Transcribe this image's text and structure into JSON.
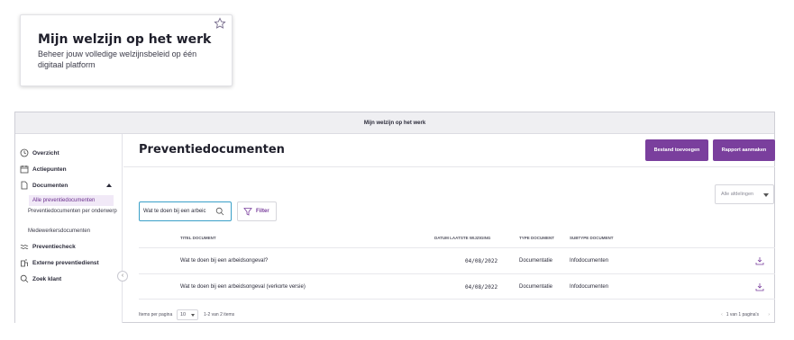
{
  "card": {
    "title": "Mijn welzijn op het werk",
    "subtitle": "Beheer jouw volledige welzijnsbeleid op één digitaal platform"
  },
  "app": {
    "window_title": "Mijn welzijn op het werk",
    "sidebar": {
      "items": [
        {
          "label": "Overzicht",
          "icon": "clock-icon"
        },
        {
          "label": "Actiepunten",
          "icon": "calendar-icon"
        },
        {
          "label": "Documenten",
          "icon": "document-icon"
        },
        {
          "label": "Preventiecheck",
          "icon": "wave-icon"
        },
        {
          "label": "Externe preventiedienst",
          "icon": "building-icon"
        },
        {
          "label": "Zoek klant",
          "icon": "search-icon"
        }
      ],
      "subitems": [
        {
          "label": "Alle preventiedocumenten",
          "active": true
        },
        {
          "label": "Preventiedocumenten per onderwerp",
          "active": false
        },
        {
          "label": "Medewerkersdocumenten",
          "active": false
        }
      ]
    },
    "main": {
      "title": "Preventiedocumenten",
      "buttons": {
        "add": "Bestand toevoegen",
        "report": "Rapport aanmaken"
      },
      "department_select": "Alle afdelingen",
      "search_value": "Wat te doen bij een arbeic",
      "filter_label": "Filter",
      "table": {
        "headers": [
          "TITEL DOCUMENT",
          "DATUM LAATSTE WIJZIGING",
          "TYPE DOCUMENT",
          "SUBTYPE DOCUMENT"
        ],
        "rows": [
          {
            "title": "Wat te doen bij een arbeidsongeval?",
            "date": "04/08/2022",
            "type": "Documentatie",
            "subtype": "Infodocumenten"
          },
          {
            "title": "Wat te doen bij een arbeidsongeval (verkorte versie)",
            "date": "04/08/2022",
            "type": "Documentatie",
            "subtype": "Infodocumenten"
          }
        ]
      },
      "footer": {
        "items_per_page_label": "Items per pagina",
        "items_per_page": "10",
        "range": "1-2 van 2 items",
        "pagination": "1 van 1 pagina's"
      }
    }
  },
  "colors": {
    "accent": "#7a3f9d",
    "search_border": "#3aa0c8"
  }
}
